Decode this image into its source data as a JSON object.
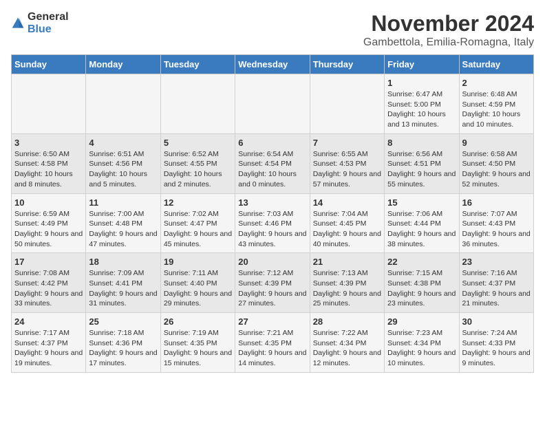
{
  "logo": {
    "general": "General",
    "blue": "Blue"
  },
  "header": {
    "month": "November 2024",
    "location": "Gambettola, Emilia-Romagna, Italy"
  },
  "days_of_week": [
    "Sunday",
    "Monday",
    "Tuesday",
    "Wednesday",
    "Thursday",
    "Friday",
    "Saturday"
  ],
  "weeks": [
    [
      {
        "day": "",
        "info": ""
      },
      {
        "day": "",
        "info": ""
      },
      {
        "day": "",
        "info": ""
      },
      {
        "day": "",
        "info": ""
      },
      {
        "day": "",
        "info": ""
      },
      {
        "day": "1",
        "info": "Sunrise: 6:47 AM\nSunset: 5:00 PM\nDaylight: 10 hours and 13 minutes."
      },
      {
        "day": "2",
        "info": "Sunrise: 6:48 AM\nSunset: 4:59 PM\nDaylight: 10 hours and 10 minutes."
      }
    ],
    [
      {
        "day": "3",
        "info": "Sunrise: 6:50 AM\nSunset: 4:58 PM\nDaylight: 10 hours and 8 minutes."
      },
      {
        "day": "4",
        "info": "Sunrise: 6:51 AM\nSunset: 4:56 PM\nDaylight: 10 hours and 5 minutes."
      },
      {
        "day": "5",
        "info": "Sunrise: 6:52 AM\nSunset: 4:55 PM\nDaylight: 10 hours and 2 minutes."
      },
      {
        "day": "6",
        "info": "Sunrise: 6:54 AM\nSunset: 4:54 PM\nDaylight: 10 hours and 0 minutes."
      },
      {
        "day": "7",
        "info": "Sunrise: 6:55 AM\nSunset: 4:53 PM\nDaylight: 9 hours and 57 minutes."
      },
      {
        "day": "8",
        "info": "Sunrise: 6:56 AM\nSunset: 4:51 PM\nDaylight: 9 hours and 55 minutes."
      },
      {
        "day": "9",
        "info": "Sunrise: 6:58 AM\nSunset: 4:50 PM\nDaylight: 9 hours and 52 minutes."
      }
    ],
    [
      {
        "day": "10",
        "info": "Sunrise: 6:59 AM\nSunset: 4:49 PM\nDaylight: 9 hours and 50 minutes."
      },
      {
        "day": "11",
        "info": "Sunrise: 7:00 AM\nSunset: 4:48 PM\nDaylight: 9 hours and 47 minutes."
      },
      {
        "day": "12",
        "info": "Sunrise: 7:02 AM\nSunset: 4:47 PM\nDaylight: 9 hours and 45 minutes."
      },
      {
        "day": "13",
        "info": "Sunrise: 7:03 AM\nSunset: 4:46 PM\nDaylight: 9 hours and 43 minutes."
      },
      {
        "day": "14",
        "info": "Sunrise: 7:04 AM\nSunset: 4:45 PM\nDaylight: 9 hours and 40 minutes."
      },
      {
        "day": "15",
        "info": "Sunrise: 7:06 AM\nSunset: 4:44 PM\nDaylight: 9 hours and 38 minutes."
      },
      {
        "day": "16",
        "info": "Sunrise: 7:07 AM\nSunset: 4:43 PM\nDaylight: 9 hours and 36 minutes."
      }
    ],
    [
      {
        "day": "17",
        "info": "Sunrise: 7:08 AM\nSunset: 4:42 PM\nDaylight: 9 hours and 33 minutes."
      },
      {
        "day": "18",
        "info": "Sunrise: 7:09 AM\nSunset: 4:41 PM\nDaylight: 9 hours and 31 minutes."
      },
      {
        "day": "19",
        "info": "Sunrise: 7:11 AM\nSunset: 4:40 PM\nDaylight: 9 hours and 29 minutes."
      },
      {
        "day": "20",
        "info": "Sunrise: 7:12 AM\nSunset: 4:39 PM\nDaylight: 9 hours and 27 minutes."
      },
      {
        "day": "21",
        "info": "Sunrise: 7:13 AM\nSunset: 4:39 PM\nDaylight: 9 hours and 25 minutes."
      },
      {
        "day": "22",
        "info": "Sunrise: 7:15 AM\nSunset: 4:38 PM\nDaylight: 9 hours and 23 minutes."
      },
      {
        "day": "23",
        "info": "Sunrise: 7:16 AM\nSunset: 4:37 PM\nDaylight: 9 hours and 21 minutes."
      }
    ],
    [
      {
        "day": "24",
        "info": "Sunrise: 7:17 AM\nSunset: 4:37 PM\nDaylight: 9 hours and 19 minutes."
      },
      {
        "day": "25",
        "info": "Sunrise: 7:18 AM\nSunset: 4:36 PM\nDaylight: 9 hours and 17 minutes."
      },
      {
        "day": "26",
        "info": "Sunrise: 7:19 AM\nSunset: 4:35 PM\nDaylight: 9 hours and 15 minutes."
      },
      {
        "day": "27",
        "info": "Sunrise: 7:21 AM\nSunset: 4:35 PM\nDaylight: 9 hours and 14 minutes."
      },
      {
        "day": "28",
        "info": "Sunrise: 7:22 AM\nSunset: 4:34 PM\nDaylight: 9 hours and 12 minutes."
      },
      {
        "day": "29",
        "info": "Sunrise: 7:23 AM\nSunset: 4:34 PM\nDaylight: 9 hours and 10 minutes."
      },
      {
        "day": "30",
        "info": "Sunrise: 7:24 AM\nSunset: 4:33 PM\nDaylight: 9 hours and 9 minutes."
      }
    ]
  ]
}
